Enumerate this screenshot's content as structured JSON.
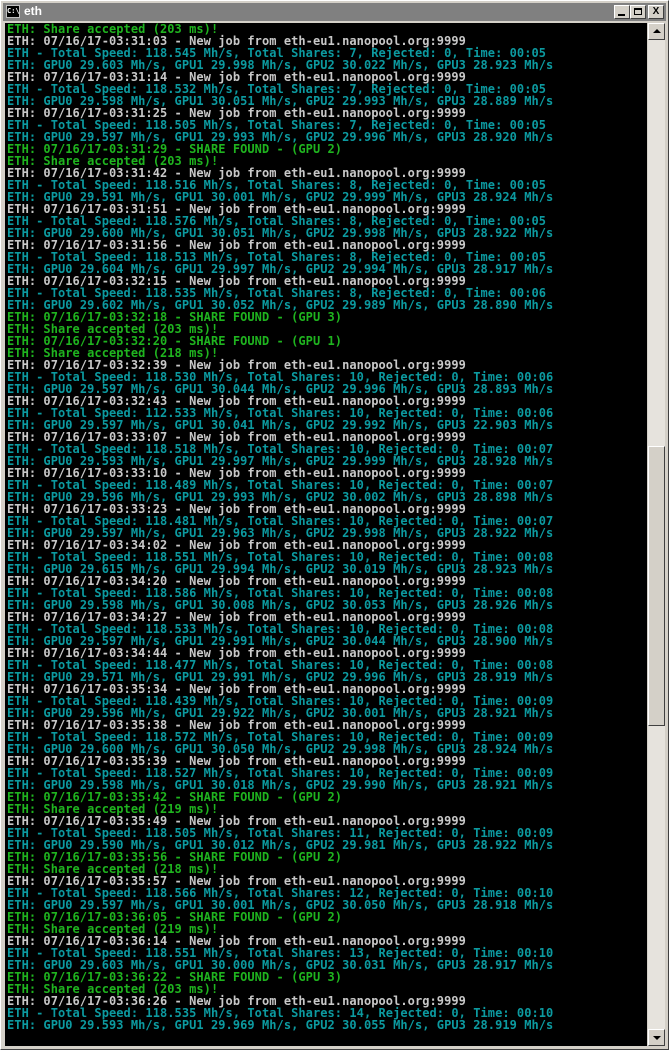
{
  "window": {
    "title": "eth",
    "app_icon_text": "C:\\",
    "buttons": {
      "minimize": "_",
      "maximize": "□",
      "close": "X"
    }
  },
  "colors": {
    "console_background": "#000000",
    "white_text": "#c8c8c8",
    "teal_text": "#0c9aa0",
    "green_text": "#1fb41f"
  },
  "console": {
    "lines": [
      {
        "text": "ETH: Share accepted (203 ms)!",
        "color": "green"
      },
      {
        "text": "ETH: 07/16/17-03:31:03 - New job from eth-eu1.nanopool.org:9999",
        "color": "white"
      },
      {
        "text": "ETH - Total Speed: 118.545 Mh/s, Total Shares: 7, Rejected: 0, Time: 00:05",
        "color": "teal"
      },
      {
        "text": "ETH: GPU0 29.603 Mh/s, GPU1 29.998 Mh/s, GPU2 30.022 Mh/s, GPU3 28.923 Mh/s",
        "color": "teal"
      },
      {
        "text": "ETH: 07/16/17-03:31:14 - New job from eth-eu1.nanopool.org:9999",
        "color": "white"
      },
      {
        "text": "ETH - Total Speed: 118.532 Mh/s, Total Shares: 7, Rejected: 0, Time: 00:05",
        "color": "teal"
      },
      {
        "text": "ETH: GPU0 29.598 Mh/s, GPU1 30.051 Mh/s, GPU2 29.993 Mh/s, GPU3 28.889 Mh/s",
        "color": "teal"
      },
      {
        "text": "ETH: 07/16/17-03:31:25 - New job from eth-eu1.nanopool.org:9999",
        "color": "white"
      },
      {
        "text": "ETH - Total Speed: 118.505 Mh/s, Total Shares: 7, Rejected: 0, Time: 00:05",
        "color": "teal"
      },
      {
        "text": "ETH: GPU0 29.597 Mh/s, GPU1 29.993 Mh/s, GPU2 29.996 Mh/s, GPU3 28.920 Mh/s",
        "color": "teal"
      },
      {
        "text": "ETH: 07/16/17-03:31:29 - SHARE FOUND - (GPU 2)",
        "color": "green"
      },
      {
        "text": "ETH: Share accepted (203 ms)!",
        "color": "green"
      },
      {
        "text": "ETH: 07/16/17-03:31:42 - New job from eth-eu1.nanopool.org:9999",
        "color": "white"
      },
      {
        "text": "ETH - Total Speed: 118.516 Mh/s, Total Shares: 8, Rejected: 0, Time: 00:05",
        "color": "teal"
      },
      {
        "text": "ETH: GPU0 29.591 Mh/s, GPU1 30.001 Mh/s, GPU2 29.999 Mh/s, GPU3 28.924 Mh/s",
        "color": "teal"
      },
      {
        "text": "ETH: 07/16/17-03:31:51 - New job from eth-eu1.nanopool.org:9999",
        "color": "white"
      },
      {
        "text": "ETH - Total Speed: 118.576 Mh/s, Total Shares: 8, Rejected: 0, Time: 00:05",
        "color": "teal"
      },
      {
        "text": "ETH: GPU0 29.600 Mh/s, GPU1 30.051 Mh/s, GPU2 29.998 Mh/s, GPU3 28.922 Mh/s",
        "color": "teal"
      },
      {
        "text": "ETH: 07/16/17-03:31:56 - New job from eth-eu1.nanopool.org:9999",
        "color": "white"
      },
      {
        "text": "ETH - Total Speed: 118.513 Mh/s, Total Shares: 8, Rejected: 0, Time: 00:05",
        "color": "teal"
      },
      {
        "text": "ETH: GPU0 29.604 Mh/s, GPU1 29.997 Mh/s, GPU2 29.994 Mh/s, GPU3 28.917 Mh/s",
        "color": "teal"
      },
      {
        "text": "ETH: 07/16/17-03:32:15 - New job from eth-eu1.nanopool.org:9999",
        "color": "white"
      },
      {
        "text": "ETH - Total Speed: 118.535 Mh/s, Total Shares: 8, Rejected: 0, Time: 00:06",
        "color": "teal"
      },
      {
        "text": "ETH: GPU0 29.602 Mh/s, GPU1 30.052 Mh/s, GPU2 29.989 Mh/s, GPU3 28.890 Mh/s",
        "color": "teal"
      },
      {
        "text": "ETH: 07/16/17-03:32:18 - SHARE FOUND - (GPU 3)",
        "color": "green"
      },
      {
        "text": "ETH: Share accepted (203 ms)!",
        "color": "green"
      },
      {
        "text": "ETH: 07/16/17-03:32:20 - SHARE FOUND - (GPU 1)",
        "color": "green"
      },
      {
        "text": "ETH: Share accepted (218 ms)!",
        "color": "green"
      },
      {
        "text": "ETH: 07/16/17-03:32:39 - New job from eth-eu1.nanopool.org:9999",
        "color": "white"
      },
      {
        "text": "ETH - Total Speed: 118.530 Mh/s, Total Shares: 10, Rejected: 0, Time: 00:06",
        "color": "teal"
      },
      {
        "text": "ETH: GPU0 29.597 Mh/s, GPU1 30.044 Mh/s, GPU2 29.996 Mh/s, GPU3 28.893 Mh/s",
        "color": "teal"
      },
      {
        "text": "ETH: 07/16/17-03:32:43 - New job from eth-eu1.nanopool.org:9999",
        "color": "white"
      },
      {
        "text": "ETH - Total Speed: 112.533 Mh/s, Total Shares: 10, Rejected: 0, Time: 00:06",
        "color": "teal"
      },
      {
        "text": "ETH: GPU0 29.597 Mh/s, GPU1 30.041 Mh/s, GPU2 29.992 Mh/s, GPU3 22.903 Mh/s",
        "color": "teal"
      },
      {
        "text": "ETH: 07/16/17-03:33:07 - New job from eth-eu1.nanopool.org:9999",
        "color": "white"
      },
      {
        "text": "ETH - Total Speed: 118.518 Mh/s, Total Shares: 10, Rejected: 0, Time: 00:07",
        "color": "teal"
      },
      {
        "text": "ETH: GPU0 29.593 Mh/s, GPU1 29.997 Mh/s, GPU2 29.999 Mh/s, GPU3 28.928 Mh/s",
        "color": "teal"
      },
      {
        "text": "ETH: 07/16/17-03:33:10 - New job from eth-eu1.nanopool.org:9999",
        "color": "white"
      },
      {
        "text": "ETH - Total Speed: 118.489 Mh/s, Total Shares: 10, Rejected: 0, Time: 00:07",
        "color": "teal"
      },
      {
        "text": "ETH: GPU0 29.596 Mh/s, GPU1 29.993 Mh/s, GPU2 30.002 Mh/s, GPU3 28.898 Mh/s",
        "color": "teal"
      },
      {
        "text": "ETH: 07/16/17-03:33:23 - New job from eth-eu1.nanopool.org:9999",
        "color": "white"
      },
      {
        "text": "ETH - Total Speed: 118.481 Mh/s, Total Shares: 10, Rejected: 0, Time: 00:07",
        "color": "teal"
      },
      {
        "text": "ETH: GPU0 29.597 Mh/s, GPU1 29.963 Mh/s, GPU2 29.998 Mh/s, GPU3 28.922 Mh/s",
        "color": "teal"
      },
      {
        "text": "ETH: 07/16/17-03:34:02 - New job from eth-eu1.nanopool.org:9999",
        "color": "white"
      },
      {
        "text": "ETH - Total Speed: 118.551 Mh/s, Total Shares: 10, Rejected: 0, Time: 00:08",
        "color": "teal"
      },
      {
        "text": "ETH: GPU0 29.615 Mh/s, GPU1 29.994 Mh/s, GPU2 30.019 Mh/s, GPU3 28.923 Mh/s",
        "color": "teal"
      },
      {
        "text": "ETH: 07/16/17-03:34:20 - New job from eth-eu1.nanopool.org:9999",
        "color": "white"
      },
      {
        "text": "ETH - Total Speed: 118.586 Mh/s, Total Shares: 10, Rejected: 0, Time: 00:08",
        "color": "teal"
      },
      {
        "text": "ETH: GPU0 29.598 Mh/s, GPU1 30.008 Mh/s, GPU2 30.053 Mh/s, GPU3 28.926 Mh/s",
        "color": "teal"
      },
      {
        "text": "ETH: 07/16/17-03:34:27 - New job from eth-eu1.nanopool.org:9999",
        "color": "white"
      },
      {
        "text": "ETH - Total Speed: 118.533 Mh/s, Total Shares: 10, Rejected: 0, Time: 00:08",
        "color": "teal"
      },
      {
        "text": "ETH: GPU0 29.597 Mh/s, GPU1 29.991 Mh/s, GPU2 30.044 Mh/s, GPU3 28.900 Mh/s",
        "color": "teal"
      },
      {
        "text": "ETH: 07/16/17-03:34:44 - New job from eth-eu1.nanopool.org:9999",
        "color": "white"
      },
      {
        "text": "ETH - Total Speed: 118.477 Mh/s, Total Shares: 10, Rejected: 0, Time: 00:08",
        "color": "teal"
      },
      {
        "text": "ETH: GPU0 29.571 Mh/s, GPU1 29.991 Mh/s, GPU2 29.996 Mh/s, GPU3 28.919 Mh/s",
        "color": "teal"
      },
      {
        "text": "ETH: 07/16/17-03:35:34 - New job from eth-eu1.nanopool.org:9999",
        "color": "white"
      },
      {
        "text": "ETH - Total Speed: 118.439 Mh/s, Total Shares: 10, Rejected: 0, Time: 00:09",
        "color": "teal"
      },
      {
        "text": "ETH: GPU0 29.596 Mh/s, GPU1 29.922 Mh/s, GPU2 30.001 Mh/s, GPU3 28.921 Mh/s",
        "color": "teal"
      },
      {
        "text": "ETH: 07/16/17-03:35:38 - New job from eth-eu1.nanopool.org:9999",
        "color": "white"
      },
      {
        "text": "ETH - Total Speed: 118.572 Mh/s, Total Shares: 10, Rejected: 0, Time: 00:09",
        "color": "teal"
      },
      {
        "text": "ETH: GPU0 29.600 Mh/s, GPU1 30.050 Mh/s, GPU2 29.998 Mh/s, GPU3 28.924 Mh/s",
        "color": "teal"
      },
      {
        "text": "ETH: 07/16/17-03:35:39 - New job from eth-eu1.nanopool.org:9999",
        "color": "white"
      },
      {
        "text": "ETH - Total Speed: 118.527 Mh/s, Total Shares: 10, Rejected: 0, Time: 00:09",
        "color": "teal"
      },
      {
        "text": "ETH: GPU0 29.598 Mh/s, GPU1 30.018 Mh/s, GPU2 29.990 Mh/s, GPU3 28.921 Mh/s",
        "color": "teal"
      },
      {
        "text": "ETH: 07/16/17-03:35:42 - SHARE FOUND - (GPU 2)",
        "color": "green"
      },
      {
        "text": "ETH: Share accepted (219 ms)!",
        "color": "green"
      },
      {
        "text": "ETH: 07/16/17-03:35:49 - New job from eth-eu1.nanopool.org:9999",
        "color": "white"
      },
      {
        "text": "ETH - Total Speed: 118.505 Mh/s, Total Shares: 11, Rejected: 0, Time: 00:09",
        "color": "teal"
      },
      {
        "text": "ETH: GPU0 29.590 Mh/s, GPU1 30.012 Mh/s, GPU2 29.981 Mh/s, GPU3 28.922 Mh/s",
        "color": "teal"
      },
      {
        "text": "ETH: 07/16/17-03:35:56 - SHARE FOUND - (GPU 2)",
        "color": "green"
      },
      {
        "text": "ETH: Share accepted (218 ms)!",
        "color": "green"
      },
      {
        "text": "ETH: 07/16/17-03:35:57 - New job from eth-eu1.nanopool.org:9999",
        "color": "white"
      },
      {
        "text": "ETH - Total Speed: 118.566 Mh/s, Total Shares: 12, Rejected: 0, Time: 00:10",
        "color": "teal"
      },
      {
        "text": "ETH: GPU0 29.597 Mh/s, GPU1 30.001 Mh/s, GPU2 30.050 Mh/s, GPU3 28.918 Mh/s",
        "color": "teal"
      },
      {
        "text": "ETH: 07/16/17-03:36:05 - SHARE FOUND - (GPU 2)",
        "color": "green"
      },
      {
        "text": "ETH: Share accepted (219 ms)!",
        "color": "green"
      },
      {
        "text": "ETH: 07/16/17-03:36:14 - New job from eth-eu1.nanopool.org:9999",
        "color": "white"
      },
      {
        "text": "ETH - Total Speed: 118.551 Mh/s, Total Shares: 13, Rejected: 0, Time: 00:10",
        "color": "teal"
      },
      {
        "text": "ETH: GPU0 29.603 Mh/s, GPU1 30.000 Mh/s, GPU2 30.031 Mh/s, GPU3 28.917 Mh/s",
        "color": "teal"
      },
      {
        "text": "ETH: 07/16/17-03:36:22 - SHARE FOUND - (GPU 3)",
        "color": "green"
      },
      {
        "text": "ETH: Share accepted (203 ms)!",
        "color": "green"
      },
      {
        "text": "ETH: 07/16/17-03:36:26 - New job from eth-eu1.nanopool.org:9999",
        "color": "white"
      },
      {
        "text": "ETH - Total Speed: 118.535 Mh/s, Total Shares: 14, Rejected: 0, Time: 00:10",
        "color": "teal"
      },
      {
        "text": "ETH: GPU0 29.593 Mh/s, GPU1 29.969 Mh/s, GPU2 30.055 Mh/s, GPU3 28.919 Mh/s",
        "color": "teal"
      }
    ]
  }
}
